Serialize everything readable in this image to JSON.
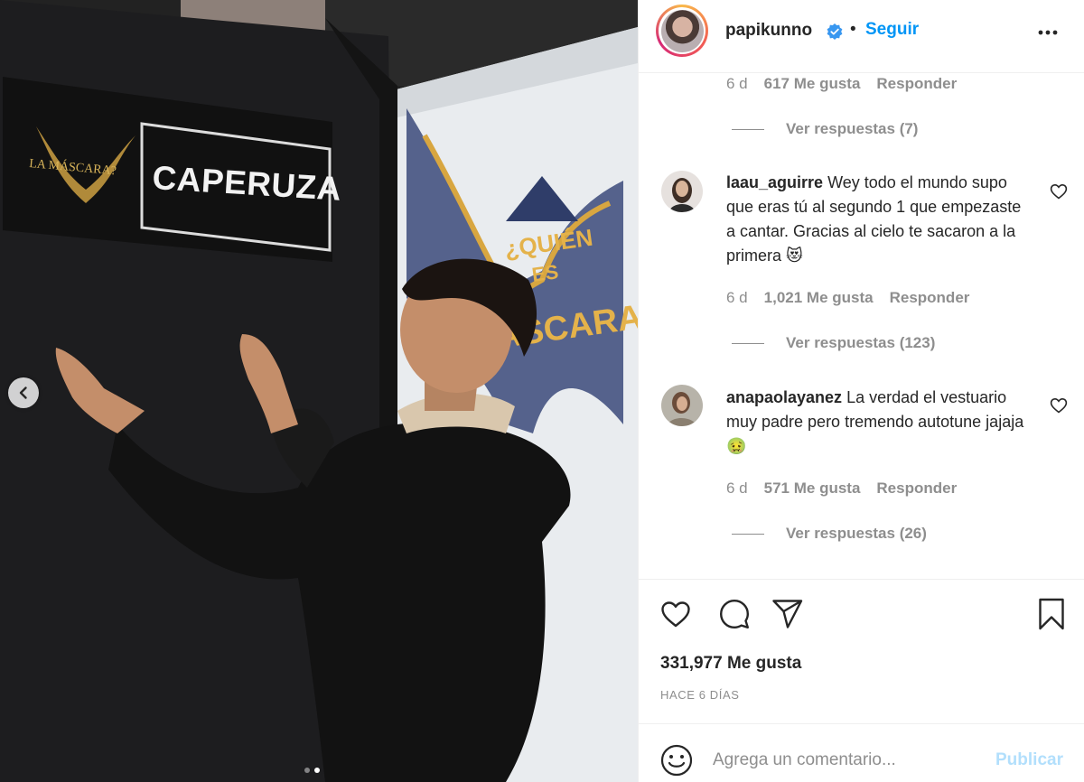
{
  "post": {
    "sign_text": "CAPERUZA",
    "carousel": {
      "total": 2,
      "active": 2
    }
  },
  "header": {
    "username": "papikunno",
    "separator": "•",
    "follow_label": "Seguir"
  },
  "comments": {
    "top_meta": {
      "age": "6 d",
      "likes": "617 Me gusta",
      "reply": "Responder"
    },
    "top_view_replies": "Ver respuestas (7)",
    "items": [
      {
        "user": "laau_aguirre",
        "text": "Wey todo el mundo supo que eras tú al segundo 1 que empezaste a cantar. Gracias al cielo te sacaron a la primera 😻",
        "age": "6 d",
        "likes": "1,021 Me gusta",
        "reply": "Responder",
        "view_replies": "Ver respuestas (123)"
      },
      {
        "user": "anapaolayanez",
        "text": "La verdad el vestuario muy padre pero tremendo autotune jajaja 🤢",
        "age": "6 d",
        "likes": "571 Me gusta",
        "reply": "Responder",
        "view_replies": "Ver respuestas (26)"
      }
    ]
  },
  "actions": {
    "icons": [
      "heart-icon",
      "comment-icon",
      "share-icon",
      "bookmark-icon"
    ],
    "likes_count": "331,977 Me gusta",
    "time_ago": "HACE 6 DÍAS"
  },
  "add_comment": {
    "placeholder": "Agrega un comentario...",
    "publish_label": "Publicar"
  },
  "colors": {
    "accent_blue": "#0095f6",
    "publish_disabled": "#b2dffc",
    "secondary_text": "#8e8e8e",
    "primary_text": "#262626"
  }
}
